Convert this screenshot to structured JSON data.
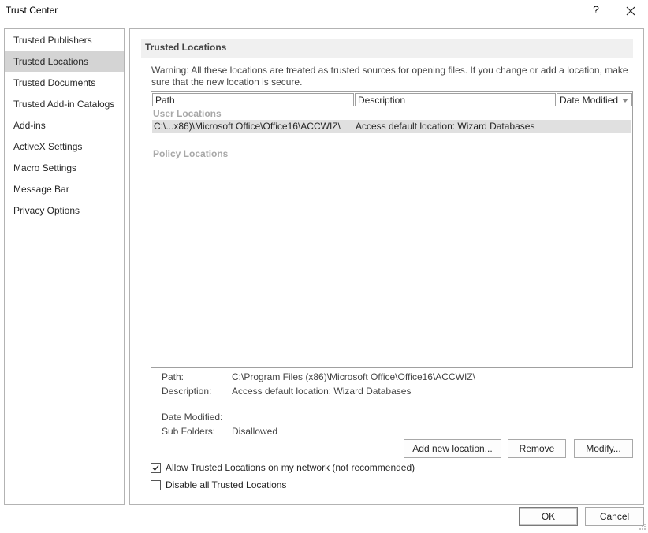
{
  "window": {
    "title": "Trust Center",
    "help_glyph": "?"
  },
  "sidebar": {
    "items": [
      {
        "label": "Trusted Publishers",
        "selected": false
      },
      {
        "label": "Trusted Locations",
        "selected": true
      },
      {
        "label": "Trusted Documents",
        "selected": false
      },
      {
        "label": "Trusted Add-in Catalogs",
        "selected": false
      },
      {
        "label": "Add-ins",
        "selected": false
      },
      {
        "label": "ActiveX Settings",
        "selected": false
      },
      {
        "label": "Macro Settings",
        "selected": false
      },
      {
        "label": "Message Bar",
        "selected": false
      },
      {
        "label": "Privacy Options",
        "selected": false
      }
    ]
  },
  "main": {
    "section_title": "Trusted Locations",
    "warning": "Warning: All these locations are treated as trusted sources for opening files.  If you change or add a location, make sure that the new location is secure.",
    "list": {
      "columns": [
        "Path",
        "Description",
        "Date Modified"
      ],
      "groups": {
        "user": "User Locations",
        "policy": "Policy Locations"
      },
      "rows": [
        {
          "path": "C:\\...x86)\\Microsoft Office\\Office16\\ACCWIZ\\",
          "description": "Access default location: Wizard Databases",
          "date_modified": ""
        }
      ]
    },
    "details": {
      "path_label": "Path:",
      "path_value": "C:\\Program Files (x86)\\Microsoft Office\\Office16\\ACCWIZ\\",
      "description_label": "Description:",
      "description_value": "Access default location: Wizard Databases",
      "date_modified_label": "Date Modified:",
      "date_modified_value": "",
      "sub_folders_label": "Sub Folders:",
      "sub_folders_value": "Disallowed"
    },
    "buttons": {
      "add": "Add new location...",
      "remove": "Remove",
      "modify": "Modify..."
    },
    "options": {
      "allow_network_label": "Allow Trusted Locations on my network (not recommended)",
      "allow_network_checked": true,
      "disable_all_label": "Disable all Trusted Locations",
      "disable_all_checked": false
    }
  },
  "footer": {
    "ok": "OK",
    "cancel": "Cancel"
  },
  "colors": {
    "selected_bg": "#d4d4d4",
    "row_highlight": "#e0e0e0",
    "border": "#b3b3b3"
  }
}
